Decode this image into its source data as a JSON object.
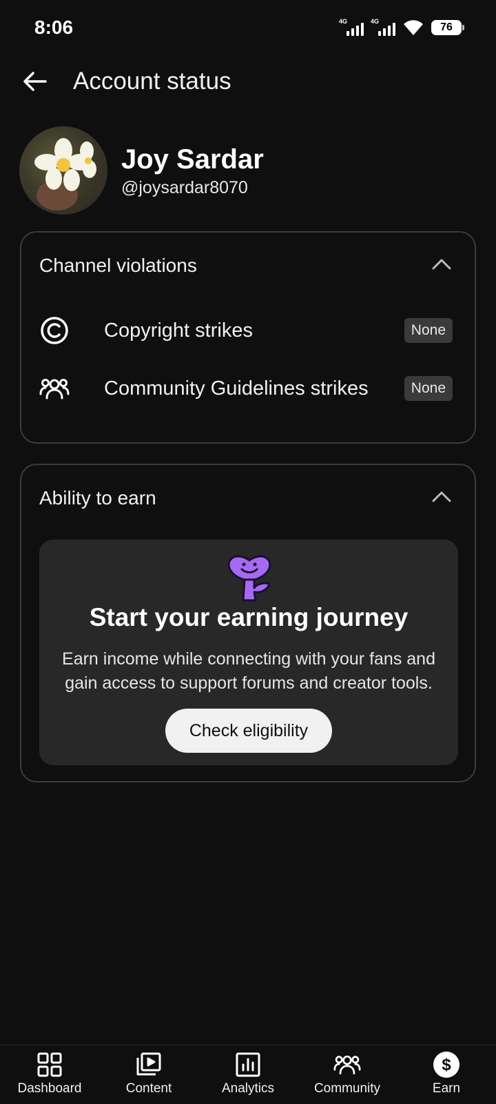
{
  "status_bar": {
    "time": "8:06",
    "signal_1_label": "4G",
    "signal_2_label": "4G",
    "battery": "76"
  },
  "header": {
    "title": "Account status",
    "back_icon": "arrow-left-icon"
  },
  "profile": {
    "name": "Joy Sardar",
    "handle": "@joysardar8070"
  },
  "violations": {
    "title": "Channel violations",
    "items": [
      {
        "icon": "copyright-icon",
        "label": "Copyright strikes",
        "status": "None"
      },
      {
        "icon": "community-icon",
        "label": "Community Guidelines strikes",
        "status": "None"
      }
    ]
  },
  "earn": {
    "title": "Ability to earn",
    "headline": "Start your earning journey",
    "description": "Earn income while connecting with your fans and gain access to support forums and creator tools.",
    "button": "Check eligibility",
    "mascot_color": "#a66af2"
  },
  "bottom_nav": [
    {
      "label": "Dashboard",
      "icon": "dashboard-icon"
    },
    {
      "label": "Content",
      "icon": "content-icon"
    },
    {
      "label": "Analytics",
      "icon": "analytics-icon"
    },
    {
      "label": "Community",
      "icon": "community-icon"
    },
    {
      "label": "Earn",
      "icon": "dollar-icon",
      "active": true
    }
  ]
}
